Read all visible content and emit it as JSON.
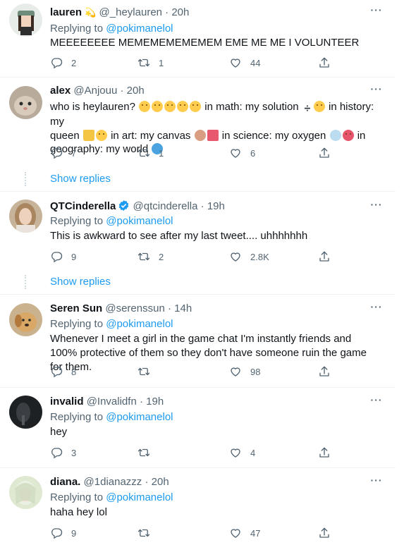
{
  "replying_label": "Replying to",
  "show_replies_label": "Show replies",
  "tweets": [
    {
      "name": "lauren",
      "handle": "@_heylauren",
      "time": "20h",
      "replying_to": "@pokimanelol",
      "text": "MEEEEEEEE MEMEMEMEMEMEM EME ME ME I VOLUNTEER",
      "replies": "2",
      "retweets": "1",
      "likes": "44"
    },
    {
      "name": "alex",
      "handle": "@Anjouu",
      "time": "20h",
      "text_parts": [
        "who is heylauren?",
        "in math: my solution",
        "in history: my",
        "queen",
        "in art: my canvas",
        "in science: my oxygen",
        "in",
        "geography: my world"
      ],
      "replies": "7",
      "retweets": "1",
      "likes": "6"
    },
    {
      "name": "QTCinderella",
      "handle": "@qtcinderella",
      "time": "19h",
      "replying_to": "@pokimanelol",
      "text": "This is awkward to see after my last tweet.... uhhhhhhh",
      "replies": "9",
      "retweets": "2",
      "likes": "2.8K"
    },
    {
      "name": "Seren Sun",
      "handle": "@serenssun",
      "time": "14h",
      "replying_to": "@pokimanelol",
      "text": "Whenever I meet a girl in the game chat I'm instantly friends and 100% protective of them so they don't have someone ruin the game for them.",
      "replies": "8",
      "retweets": "",
      "likes": "98"
    },
    {
      "name": "invalid",
      "handle": "@Invalidfn",
      "time": "19h",
      "replying_to": "@pokimanelol",
      "text": "hey",
      "replies": "3",
      "retweets": "",
      "likes": "4"
    },
    {
      "name": "diana.",
      "handle": "@1dianazzz",
      "time": "20h",
      "replying_to": "@pokimanelol",
      "text": "haha hey lol",
      "replies": "9",
      "retweets": "",
      "likes": "47"
    }
  ],
  "colors": {
    "accent": "#1d9bf0",
    "secondary_text": "#536471",
    "border": "#eff3f4"
  },
  "icons": [
    "reply-icon",
    "retweet-icon",
    "like-icon",
    "share-icon",
    "more-icon",
    "verified-icon"
  ]
}
